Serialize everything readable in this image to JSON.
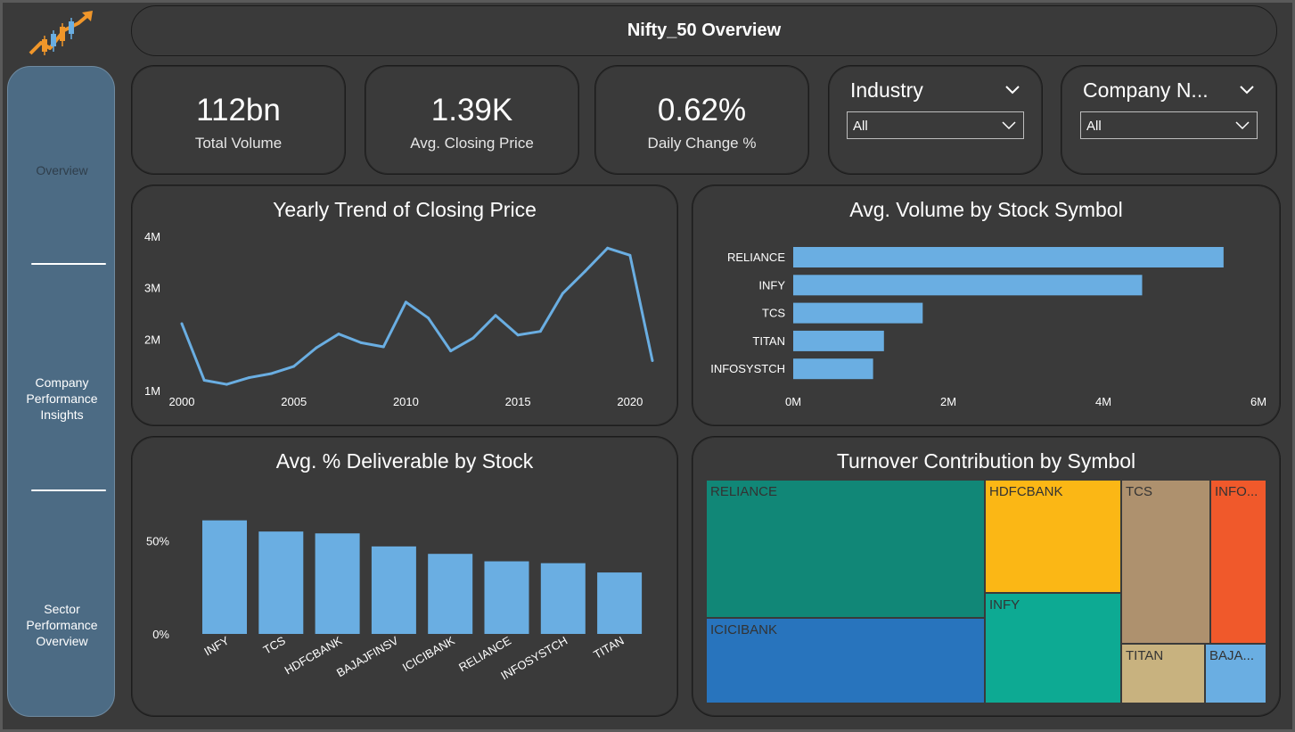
{
  "title": "Nifty_50 Overview",
  "colors": {
    "background": "#3a3a3a",
    "sidebar": "#4c6b84",
    "accent_blue": "#6aaee2",
    "logo_orange": "#f0962a"
  },
  "sidebar": {
    "items": [
      {
        "label": "Overview",
        "active": true
      },
      {
        "label": "Company Performance Insights",
        "lines": [
          "Company",
          "Performance",
          "Insights"
        ]
      },
      {
        "label": "Sector Performance Overview",
        "lines": [
          "Sector",
          "Performance",
          "Overview"
        ]
      }
    ]
  },
  "kpis": [
    {
      "value": "112bn",
      "label": "Total Volume"
    },
    {
      "value": "1.39K",
      "label": "Avg. Closing Price"
    },
    {
      "value": "0.62%",
      "label": "Daily Change %"
    }
  ],
  "slicers": [
    {
      "title": "Industry",
      "value": "All"
    },
    {
      "title": "Company N...",
      "value": "All"
    }
  ],
  "charts": {
    "line_title": "Yearly Trend of Closing Price",
    "hbar_title": "Avg. Volume by Stock Symbol",
    "vbar_title": "Avg. % Deliverable by Stock",
    "treemap_title": "Turnover Contribution by Symbol"
  },
  "chart_data": [
    {
      "type": "line",
      "title": "Yearly Trend of Closing Price",
      "x": [
        2000,
        2001,
        2002,
        2003,
        2004,
        2005,
        2006,
        2007,
        2008,
        2009,
        2010,
        2011,
        2012,
        2013,
        2014,
        2015,
        2016,
        2017,
        2018,
        2019,
        2020,
        2021
      ],
      "values": [
        2.3,
        1.2,
        1.12,
        1.25,
        1.33,
        1.47,
        1.83,
        2.1,
        1.93,
        1.85,
        2.72,
        2.41,
        1.77,
        2.02,
        2.46,
        2.08,
        2.15,
        2.89,
        3.32,
        3.77,
        3.63,
        1.58
      ],
      "x_ticks": [
        "2000",
        "2005",
        "2010",
        "2015",
        "2020"
      ],
      "y_ticks": [
        "1M",
        "2M",
        "3M",
        "4M"
      ],
      "ylim": [
        1,
        4
      ],
      "unit": "M",
      "color": "#6aaee2"
    },
    {
      "type": "bar",
      "orientation": "horizontal",
      "title": "Avg. Volume by Stock Symbol",
      "categories": [
        "RELIANCE",
        "INFY",
        "TCS",
        "TITAN",
        "INFOSYSTCH"
      ],
      "values": [
        5.55,
        4.5,
        1.67,
        1.17,
        1.03
      ],
      "x_ticks": [
        "0M",
        "2M",
        "4M",
        "6M"
      ],
      "xlim": [
        0,
        6
      ],
      "unit": "M",
      "color": "#6aaee2"
    },
    {
      "type": "bar",
      "orientation": "vertical",
      "title": "Avg. % Deliverable by Stock",
      "categories": [
        "INFY",
        "TCS",
        "HDFCBANK",
        "BAJAJFINSV",
        "ICICIBANK",
        "RELIANCE",
        "INFOSYSTCH",
        "TITAN"
      ],
      "values": [
        61,
        55,
        54,
        47,
        43,
        39,
        38,
        33
      ],
      "y_ticks": [
        "0%",
        "50%"
      ],
      "ylim": [
        0,
        68
      ],
      "unit": "%",
      "color": "#6aaee2"
    },
    {
      "type": "treemap",
      "title": "Turnover Contribution by Symbol",
      "items": [
        {
          "label": "RELIANCE",
          "color": "#118777"
        },
        {
          "label": "ICICIBANK",
          "color": "#2874bd"
        },
        {
          "label": "HDFCBANK",
          "color": "#fbb715"
        },
        {
          "label": "INFY",
          "color": "#0daa93"
        },
        {
          "label": "TCS",
          "color": "#ae916e"
        },
        {
          "label": "INFO...",
          "color": "#f0592b"
        },
        {
          "label": "TITAN",
          "color": "#c8b27f"
        },
        {
          "label": "BAJA...",
          "color": "#6aaee2"
        }
      ]
    }
  ]
}
